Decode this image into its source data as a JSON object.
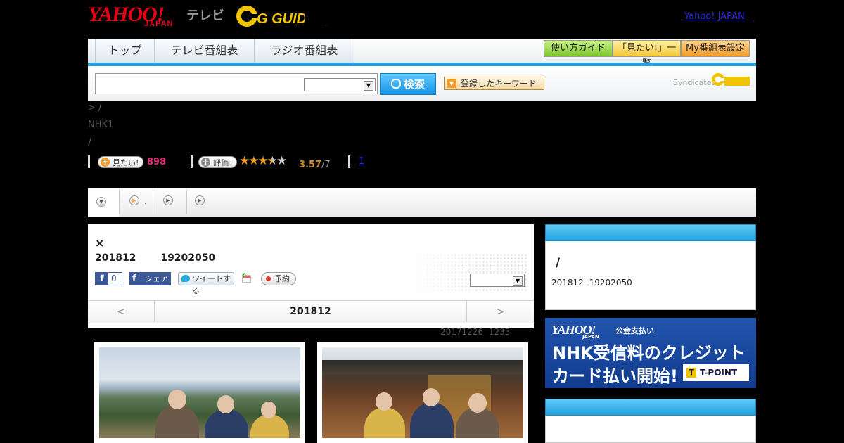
{
  "header": {
    "logo_yahoo": "YAHOO!",
    "logo_japan": "JAPAN",
    "logo_tv": "テレビ",
    "logo_gguide": "G GUIDE",
    "yahoo_japan_link": "Yahoo! JAPAN",
    "dot": ".",
    "dot2": "."
  },
  "nav": {
    "tabs": [
      "トップ",
      "テレビ番組表",
      "ラジオ番組表"
    ],
    "guide_buttons": [
      "使い方ガイド",
      "「見たい!」一覧",
      "My番組表設定"
    ]
  },
  "search": {
    "query": "",
    "placeholder": "",
    "select_value": "",
    "button_label": "検索",
    "keyword_button_label": "登録したキーワード",
    "syndicated_label": "Syndicated"
  },
  "program": {
    "breadcrumb": "> /",
    "channel": "NHK1",
    "slash": "/",
    "want_label": "見たい!",
    "want_count": "898",
    "rate_label": "評価",
    "rating_score": "3.57",
    "rating_total": "/7",
    "rating_value": 3.57,
    "rating_max": 5,
    "review_link": "1"
  },
  "tabs_band": {
    "tab2_text": "."
  },
  "episode": {
    "title_mark": "×",
    "month": "201812",
    "time": "19202050",
    "fb_count": "0",
    "fb_share_label": "シェア",
    "tweet_label": "ツイートする",
    "reserve_label": "予約",
    "select_value": "",
    "prev": "<",
    "current_month": "201812",
    "next": ">"
  },
  "updated": {
    "date": "20171226",
    "time": "1233"
  },
  "sidebar": {
    "title": "/",
    "month": "201812",
    "time": "19202050"
  },
  "ad": {
    "logo": "YAHOO!",
    "logo_sub": "JAPAN",
    "sub": "公金支払い",
    "line1": "NHK受信料のクレジット",
    "line2": "カード払い開始!",
    "tpoint_mark": "T",
    "tpoint_label": "T-POINT"
  },
  "colors": {
    "brand_red": "#e60012",
    "accent_blue": "#2aa0dd",
    "want_pink": "#e8307a",
    "star": "#f0a020"
  }
}
